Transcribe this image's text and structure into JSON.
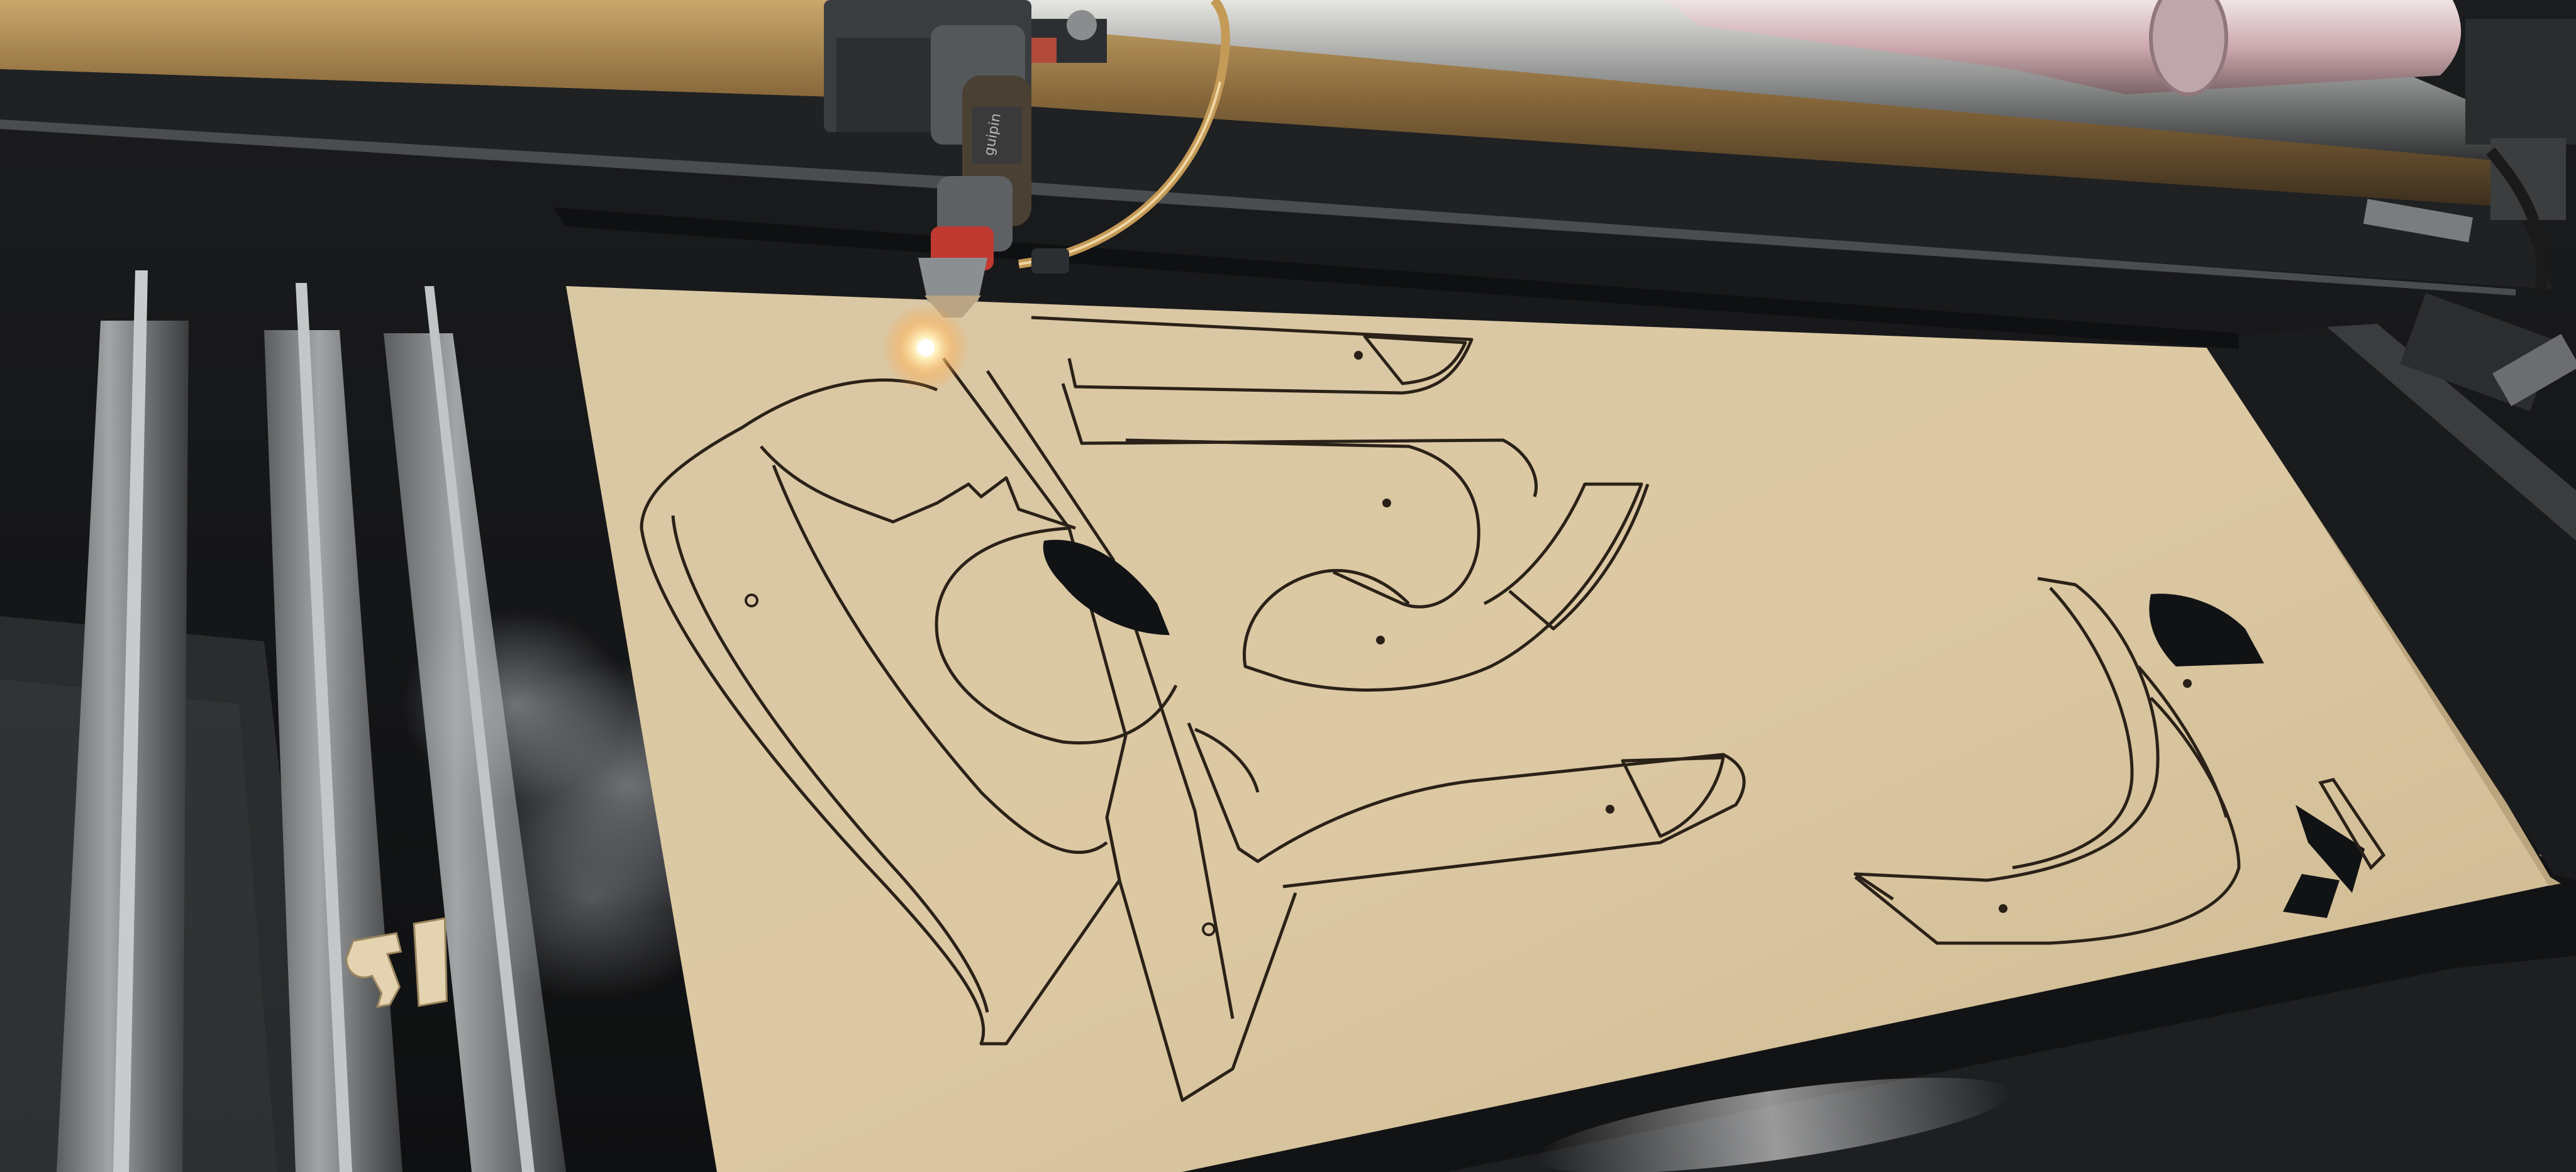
{
  "photo": {
    "subject": "laser-cutter",
    "colors": {
      "board": "#d8c5a0",
      "board_shadow": "#b9a47d",
      "cut_line": "#2a2118",
      "machine_dark": "#151617",
      "rail_brass": "#8a6a3c",
      "rail_steel": "#a8aaa8",
      "laser_glow": "#fff2c0",
      "tube_pink": "#cdb3b8",
      "smoke": "#9aa0a6"
    },
    "nozzle_brand": "guipin"
  }
}
